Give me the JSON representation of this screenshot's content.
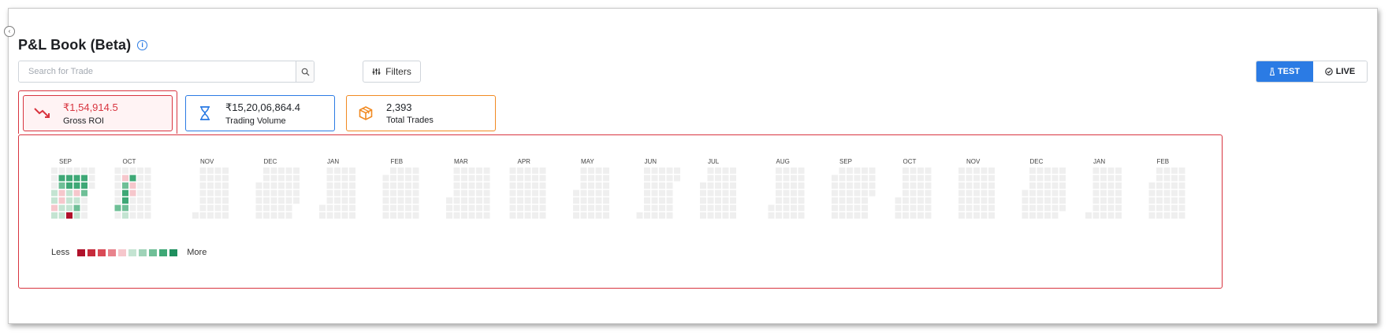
{
  "page": {
    "title": "P&L Book (Beta)",
    "title_icon": "info-icon"
  },
  "search": {
    "placeholder": "Search for Trade",
    "value": "",
    "icon": "search-icon"
  },
  "filters": {
    "label": "Filters",
    "icon": "sliders-icon"
  },
  "mode_toggle": {
    "test_label": "TEST",
    "test_icon": "flask-icon",
    "live_label": "LIVE",
    "live_icon": "check-circle-icon",
    "selected": "TEST",
    "accent": "#2b7be4"
  },
  "stats": [
    {
      "key": "gross_roi",
      "value": "₹1,54,914.5",
      "label": "Gross ROI",
      "icon": "trending-down-icon",
      "color": "#d8343f"
    },
    {
      "key": "trading_volume",
      "value": "₹15,20,06,864.4",
      "label": "Trading Volume",
      "icon": "hourglass-icon",
      "color": "#2b7be4"
    },
    {
      "key": "total_trades",
      "value": "2,393",
      "label": "Total Trades",
      "icon": "box-icon",
      "color": "#f18a22"
    }
  ],
  "heatmap": {
    "months": [
      "SEP",
      "OCT",
      "NOV",
      "DEC",
      "JAN",
      "FEB",
      "MAR",
      "APR",
      "MAY",
      "JUN",
      "JUL",
      "AUG",
      "SEP",
      "OCT",
      "NOV",
      "DEC",
      "JAN",
      "FEB"
    ],
    "empty_color": "#efefef",
    "active_cells": [
      {
        "month": 0,
        "week": 1,
        "day": 1,
        "level": 8
      },
      {
        "month": 0,
        "week": 2,
        "day": 1,
        "level": 8
      },
      {
        "month": 0,
        "week": 3,
        "day": 1,
        "level": 8
      },
      {
        "month": 0,
        "week": 4,
        "day": 1,
        "level": 8
      },
      {
        "month": 0,
        "week": 1,
        "day": 2,
        "level": 7
      },
      {
        "month": 0,
        "week": 2,
        "day": 2,
        "level": 8
      },
      {
        "month": 0,
        "week": 3,
        "day": 2,
        "level": 8
      },
      {
        "month": 0,
        "week": 4,
        "day": 2,
        "level": 8
      },
      {
        "month": 0,
        "week": 0,
        "day": 3,
        "level": 5
      },
      {
        "month": 0,
        "week": 1,
        "day": 3,
        "level": 4
      },
      {
        "month": 0,
        "week": 2,
        "day": 3,
        "level": 5
      },
      {
        "month": 0,
        "week": 3,
        "day": 3,
        "level": 4
      },
      {
        "month": 0,
        "week": 4,
        "day": 3,
        "level": 7
      },
      {
        "month": 0,
        "week": 0,
        "day": 4,
        "level": 5
      },
      {
        "month": 0,
        "week": 1,
        "day": 4,
        "level": 4
      },
      {
        "month": 0,
        "week": 2,
        "day": 4,
        "level": 5
      },
      {
        "month": 0,
        "week": 3,
        "day": 4,
        "level": 5
      },
      {
        "month": 0,
        "week": 0,
        "day": 5,
        "level": 4
      },
      {
        "month": 0,
        "week": 1,
        "day": 5,
        "level": 5
      },
      {
        "month": 0,
        "week": 2,
        "day": 5,
        "level": 5
      },
      {
        "month": 0,
        "week": 3,
        "day": 5,
        "level": 7
      },
      {
        "month": 0,
        "week": 0,
        "day": 6,
        "level": 5
      },
      {
        "month": 0,
        "week": 1,
        "day": 6,
        "level": 5
      },
      {
        "month": 0,
        "week": 2,
        "day": 6,
        "level": 0
      },
      {
        "month": 0,
        "week": 3,
        "day": 6,
        "level": 5
      },
      {
        "month": 1,
        "week": 1,
        "day": 1,
        "level": 4
      },
      {
        "month": 1,
        "week": 2,
        "day": 1,
        "level": 8
      },
      {
        "month": 1,
        "week": 1,
        "day": 2,
        "level": 7
      },
      {
        "month": 1,
        "week": 2,
        "day": 2,
        "level": 4
      },
      {
        "month": 1,
        "week": 1,
        "day": 3,
        "level": 8
      },
      {
        "month": 1,
        "week": 2,
        "day": 3,
        "level": 4
      },
      {
        "month": 1,
        "week": 1,
        "day": 4,
        "level": 8
      },
      {
        "month": 1,
        "week": 0,
        "day": 5,
        "level": 7
      },
      {
        "month": 1,
        "week": 1,
        "day": 5,
        "level": 7
      },
      {
        "month": 1,
        "week": 1,
        "day": 6,
        "level": 5
      }
    ]
  },
  "legend": {
    "less_label": "Less",
    "more_label": "More",
    "colors": [
      "#b0122b",
      "#c62a3a",
      "#d94a55",
      "#e8838c",
      "#f6c7cc",
      "#c4e4d2",
      "#9fd3b8",
      "#6fbf97",
      "#3ea876",
      "#1e8f5e"
    ]
  }
}
